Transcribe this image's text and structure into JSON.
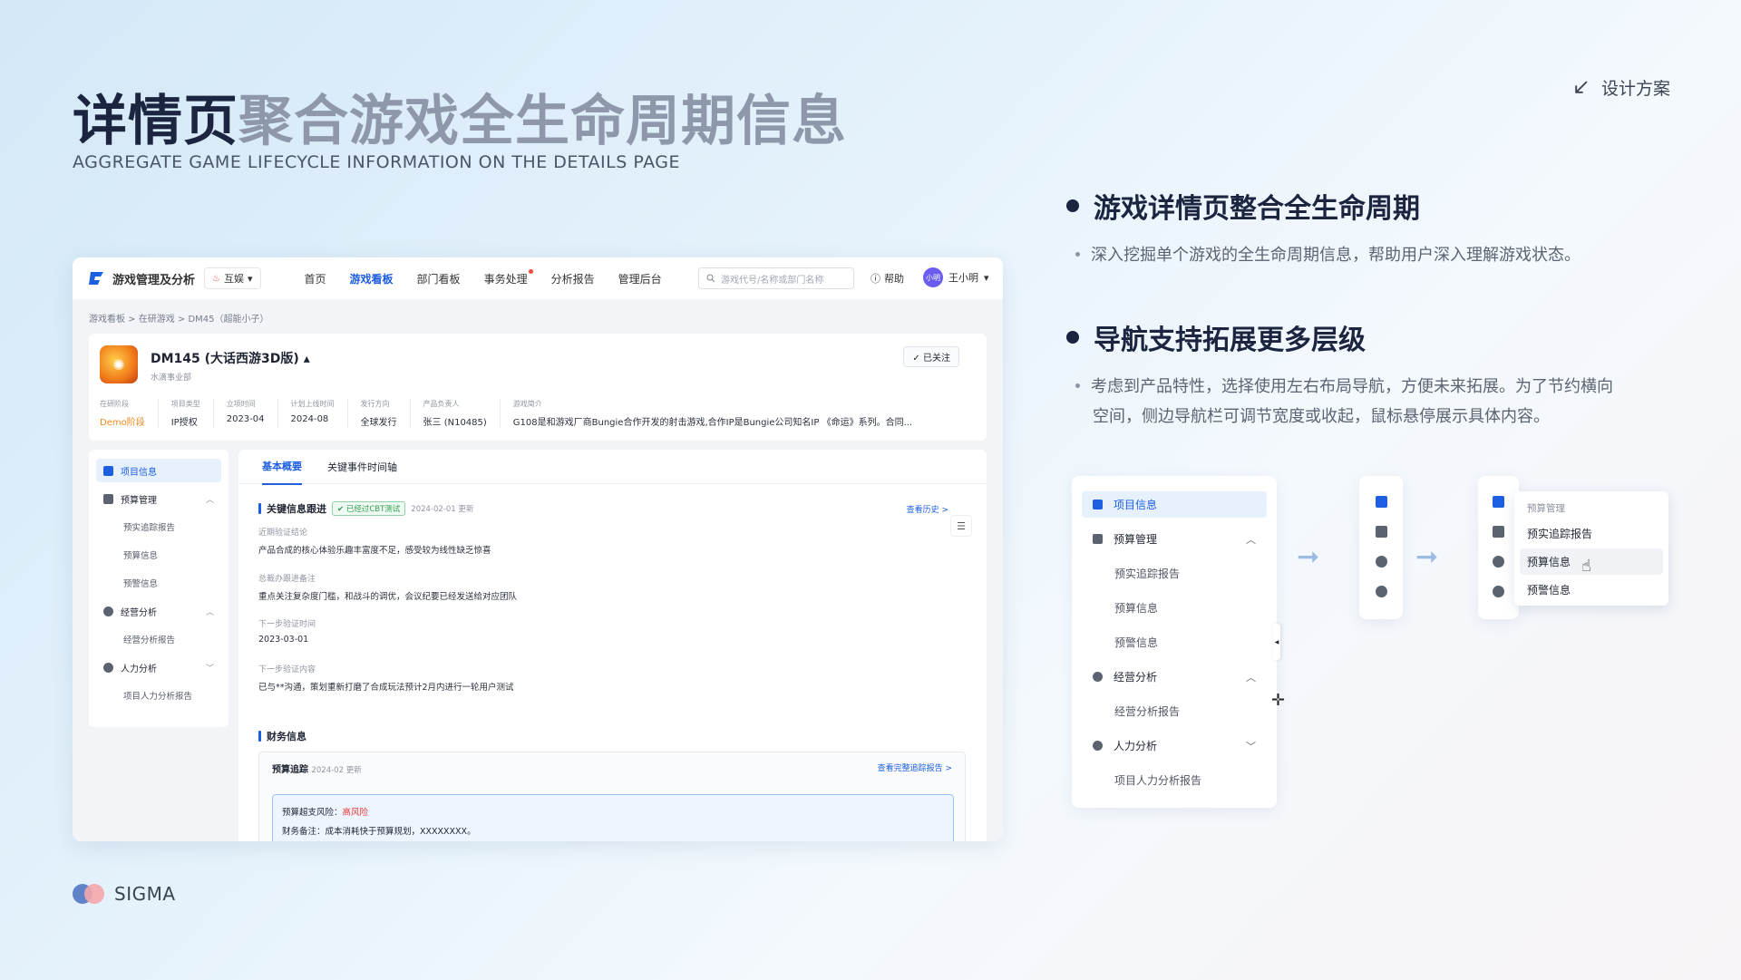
{
  "hero": {
    "title_dark": "详情页",
    "title_light": "聚合游戏全生命周期信息",
    "subtitle": "AGGREGATE GAME LIFECYCLE INFORMATION ON THE DETAILS PAGE",
    "top_link": "设计方案"
  },
  "brand": {
    "name": "SIGMA"
  },
  "app": {
    "logo_text": "游戏管理及分析",
    "switch_label": "互娱",
    "menu": [
      "首页",
      "游戏看板",
      "部门看板",
      "事务处理",
      "分析报告",
      "管理后台"
    ],
    "active_menu": "游戏看板",
    "search_placeholder": "游戏代号/名称或部门名称",
    "help": "帮助",
    "avatar_text": "小明",
    "user_name": "王小明",
    "breadcrumb": "游戏看板 > 在研游戏 > DM45（超能小子）",
    "game": {
      "name": "DM145 (大话西游3D版)",
      "org": "水滴事业部",
      "follow": "已关注",
      "fields": [
        {
          "label": "在研阶段",
          "value": "Demo阶段"
        },
        {
          "label": "项目类型",
          "value": "IP授权"
        },
        {
          "label": "立项时间",
          "value": "2023-04"
        },
        {
          "label": "计划上线时间",
          "value": "2024-08"
        },
        {
          "label": "发行方向",
          "value": "全球发行"
        },
        {
          "label": "产品负责人",
          "value": "张三 (N10485)"
        },
        {
          "label": "游戏简介",
          "value": "G108是和游戏厂商Bungie合作开发的射击游戏,合作IP是Bungie公司知名IP 《命运》系列。合同..."
        }
      ]
    },
    "sidebar": [
      {
        "label": "项目信息",
        "type": "top",
        "active": true
      },
      {
        "label": "预算管理",
        "type": "top",
        "chev": "^"
      },
      {
        "label": "预实追踪报告",
        "type": "sub"
      },
      {
        "label": "预算信息",
        "type": "sub"
      },
      {
        "label": "预警信息",
        "type": "sub"
      },
      {
        "label": "经营分析",
        "type": "top",
        "chev": "^"
      },
      {
        "label": "经营分析报告",
        "type": "sub"
      },
      {
        "label": "人力分析",
        "type": "top",
        "chev": "v"
      },
      {
        "label": "项目人力分析报告",
        "type": "sub"
      }
    ],
    "tabs": [
      "基本概要",
      "关键事件时间轴"
    ],
    "key_section": {
      "title": "关键信息跟进",
      "tag": "已经过CBT测试",
      "updated": "2024-02-01 更新",
      "history_link": "查看历史 >",
      "items": [
        {
          "k": "近期验证结论",
          "v": "产品合成的核心体验乐趣丰富度不足，感受较为线性缺乏惊喜"
        },
        {
          "k": "总裁办跟进备注",
          "v": "重点关注复杂度门槛，和战斗的调优，会议纪要已经发送给对应团队"
        },
        {
          "k": "下一步验证时间",
          "v": "2023-03-01"
        },
        {
          "k": "下一步验证内容",
          "v": "已与**沟通，策划重新打磨了合成玩法预计2月内进行一轮用户测试"
        }
      ]
    },
    "finance": {
      "title": "财务信息",
      "budget_title": "预算追踪",
      "budget_updated": "2024-02 更新",
      "report_link": "查看完整追踪报告 >",
      "risk_label": "预算超支风险：",
      "risk_value": "高风险",
      "note": "财务备注：成本消耗快于预算规划，XXXXXXXX。"
    }
  },
  "points": [
    {
      "title": "游戏详情页整合全生命周期",
      "body": "深入挖掘单个游戏的全生命周期信息，帮助用户深入理解游戏状态。"
    },
    {
      "title": "导航支持拓展更多层级",
      "body_line1": "考虑到产品特性，选择使用左右布局导航，方便未来拓展。为了节约横向",
      "body_line2": "空间，侧边导航栏可调节宽度或收起，鼠标悬停展示具体内容。"
    }
  ],
  "nav_demo": {
    "items": [
      {
        "label": "项目信息",
        "type": "top",
        "active": true
      },
      {
        "label": "预算管理",
        "type": "top",
        "chev": "^"
      },
      {
        "label": "预实追踪报告",
        "type": "sub"
      },
      {
        "label": "预算信息",
        "type": "sub"
      },
      {
        "label": "预警信息",
        "type": "sub"
      },
      {
        "label": "经营分析",
        "type": "top",
        "chev": "^"
      },
      {
        "label": "经营分析报告",
        "type": "sub"
      },
      {
        "label": "人力分析",
        "type": "top",
        "chev": "v"
      },
      {
        "label": "项目人力分析报告",
        "type": "sub"
      }
    ],
    "popover_header": "预算管理",
    "popover_items": [
      "预实追踪报告",
      "预算信息",
      "预警信息"
    ],
    "hovered_item": "预算信息"
  },
  "colors": {
    "accent": "#1d5fe0",
    "title_dark": "#1b2540",
    "title_light": "#8e98aa",
    "risk": "#e53935"
  }
}
